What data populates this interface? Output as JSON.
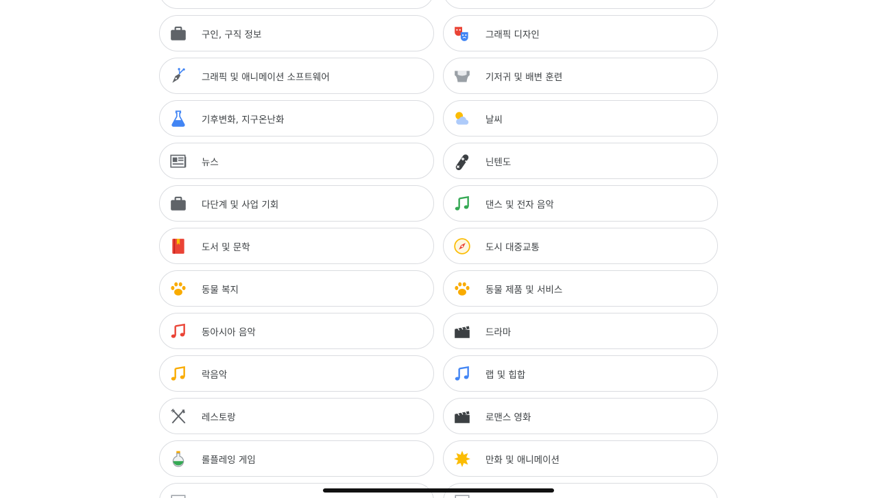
{
  "categories": [
    {
      "label": "",
      "icon": "partial-icon"
    },
    {
      "label": "",
      "icon": "partial-icon"
    },
    {
      "label": "구인, 구직 정보",
      "icon": "briefcase-icon"
    },
    {
      "label": "그래픽 디자인",
      "icon": "theater-masks-icon"
    },
    {
      "label": "그래픽 및 애니메이션 소프트웨어",
      "icon": "pen-tool-icon"
    },
    {
      "label": "기저귀 및 배변 훈련",
      "icon": "diaper-icon"
    },
    {
      "label": "기후변화, 지구온난화",
      "icon": "flask-icon"
    },
    {
      "label": "날씨",
      "icon": "weather-cloud-sun-icon"
    },
    {
      "label": "뉴스",
      "icon": "newspaper-icon"
    },
    {
      "label": "닌텐도",
      "icon": "gamepad-icon"
    },
    {
      "label": "다단계 및 사업 기회",
      "icon": "briefcase-icon"
    },
    {
      "label": "댄스 및 전자 음악",
      "icon": "music-note-green-icon"
    },
    {
      "label": "도서 및 문학",
      "icon": "book-icon"
    },
    {
      "label": "도시 대중교통",
      "icon": "compass-icon"
    },
    {
      "label": "동물 복지",
      "icon": "paw-icon"
    },
    {
      "label": "동물 제품 및 서비스",
      "icon": "paw-icon"
    },
    {
      "label": "동아시아 음악",
      "icon": "music-note-red-icon"
    },
    {
      "label": "드라마",
      "icon": "clapperboard-icon"
    },
    {
      "label": "락음악",
      "icon": "music-note-yellow-icon"
    },
    {
      "label": "랩 및 힙합",
      "icon": "music-note-blue-icon"
    },
    {
      "label": "레스토랑",
      "icon": "fork-knife-icon"
    },
    {
      "label": "로맨스 영화",
      "icon": "clapperboard-icon"
    },
    {
      "label": "롤플레잉 게임",
      "icon": "potion-icon"
    },
    {
      "label": "만화 및 애니메이션",
      "icon": "starburst-icon"
    },
    {
      "label": "",
      "icon": "partial-icon"
    },
    {
      "label": "",
      "icon": "partial-icon"
    }
  ],
  "colors": {
    "border": "#dadce0",
    "text": "#3c4043",
    "briefcase": "#5f6368",
    "music_green": "#34a853",
    "music_red": "#ea4335",
    "music_yellow": "#fbbc04",
    "music_blue": "#4285f4",
    "paw": "#f9ab00"
  }
}
